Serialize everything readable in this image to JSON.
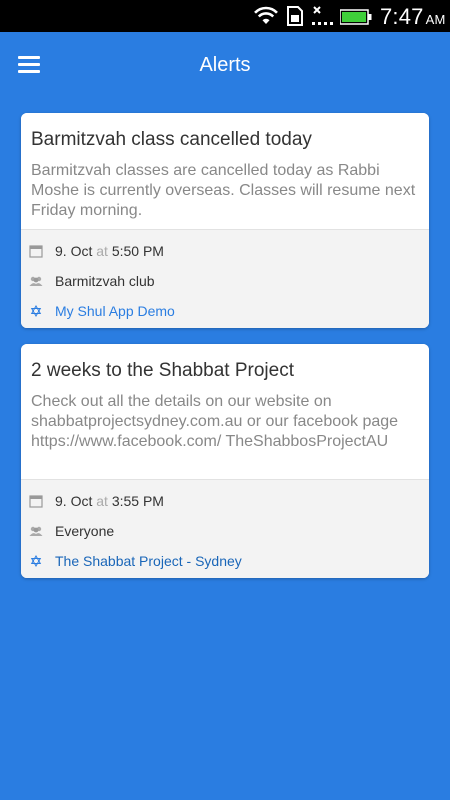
{
  "status_bar": {
    "time": "7:47",
    "ampm": "AM",
    "icons": [
      "wifi-icon",
      "sim-icon",
      "signal-off-icon",
      "battery-icon"
    ],
    "battery_color": "#3fcf3a"
  },
  "app_bar": {
    "title": "Alerts",
    "menu_icon": "hamburger-menu-icon",
    "background": "#2a7de1"
  },
  "alerts": [
    {
      "title": "Barmitzvah class cancelled today",
      "body": "Barmitzvah classes are cancelled today as Rabbi Moshe is currently overseas.  Classes will resume next Friday morning.",
      "date": "9. Oct",
      "at": "at",
      "time": "5:50 PM",
      "audience": "Barmitzvah club",
      "organization": "My Shul App Demo"
    },
    {
      "title": "2 weeks to the Shabbat Project",
      "body": "Check out all the details on our website on shabbatprojectsydney.com.au or our facebook page https://www.facebook.com/ TheShabbosProjectAU",
      "date": "9. Oct",
      "at": "at",
      "time": "3:55 PM",
      "audience": "Everyone",
      "organization": "The Shabbat Project - Sydney"
    }
  ]
}
